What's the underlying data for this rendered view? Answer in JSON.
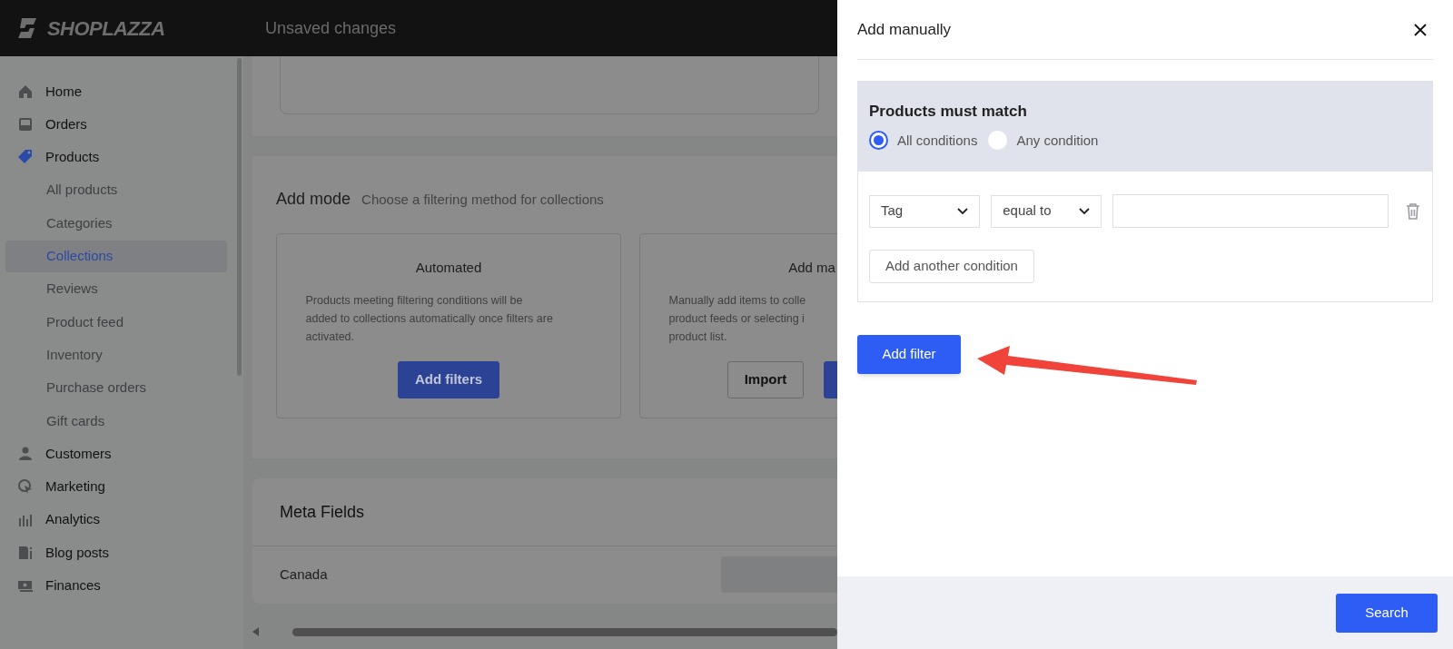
{
  "topbar": {
    "logo": "SHOPLAZZA",
    "title": "Unsaved changes"
  },
  "sidebar": {
    "items": [
      {
        "label": "Home",
        "selected": false
      },
      {
        "label": "Orders",
        "selected": false
      },
      {
        "label": "Products",
        "selected": false,
        "children": [
          {
            "label": "All products",
            "selected": false
          },
          {
            "label": "Categories",
            "selected": false
          },
          {
            "label": "Collections",
            "selected": true
          },
          {
            "label": "Reviews",
            "selected": false
          },
          {
            "label": "Product feed",
            "selected": false
          },
          {
            "label": "Inventory",
            "selected": false
          },
          {
            "label": "Purchase orders",
            "selected": false
          },
          {
            "label": "Gift cards",
            "selected": false
          }
        ]
      },
      {
        "label": "Customers",
        "selected": false
      },
      {
        "label": "Marketing",
        "selected": false
      },
      {
        "label": "Analytics",
        "selected": false
      },
      {
        "label": "Blog posts",
        "selected": false
      },
      {
        "label": "Finances",
        "selected": false
      }
    ]
  },
  "add_mode": {
    "title": "Add mode",
    "subtitle": "Choose a filtering method for collections",
    "options": [
      {
        "title": "Automated",
        "description_lines": [
          "Products meeting filtering conditions will be",
          "added to collections automatically once filters are",
          "activated."
        ],
        "buttons": [
          {
            "label": "Add filters",
            "kind": "primary"
          }
        ]
      },
      {
        "title": "Add ma",
        "description_lines": [
          "Manually add items to colle",
          "product feeds or selecting i",
          "product list."
        ],
        "buttons": [
          {
            "label": "Import",
            "kind": "secondary"
          },
          {
            "kind": "primary"
          }
        ]
      }
    ]
  },
  "meta_fields": {
    "title": "Meta Fields",
    "rows": [
      {
        "label": "Canada"
      }
    ]
  },
  "drawer": {
    "title": "Add manually",
    "match_title": "Products must match",
    "match_options": [
      {
        "label": "All conditions",
        "selected": true
      },
      {
        "label": "Any condition",
        "selected": false
      }
    ],
    "condition": {
      "field": "Tag",
      "operator": "equal to"
    },
    "add_condition": "Add another condition",
    "add_filter": "Add filter",
    "search": "Search"
  }
}
